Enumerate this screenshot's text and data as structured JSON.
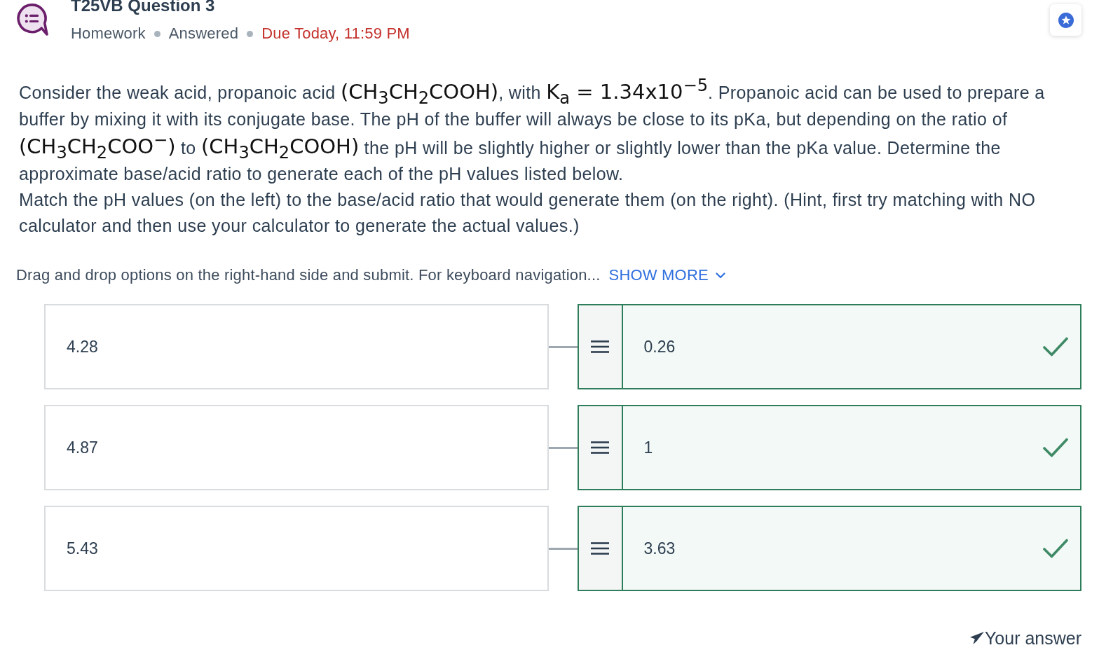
{
  "header": {
    "title": "T25VB Question 3",
    "meta": [
      {
        "kind": "type",
        "text": "Homework"
      },
      {
        "kind": "status",
        "text": "Answered"
      },
      {
        "kind": "due",
        "text": "Due Today, 11:59 PM"
      }
    ]
  },
  "question": {
    "paragraphs": [
      {
        "segments": [
          {
            "kind": "text",
            "text": "Consider the weak acid, propanoic acid "
          },
          {
            "kind": "math",
            "text": "(CH$_{3}$CH$_{2}$COOH)"
          },
          {
            "kind": "text",
            "text": ", with "
          },
          {
            "kind": "math",
            "text": "K$_{a}$ = 1.34x10$^{−5}$"
          },
          {
            "kind": "text",
            "text": ". Propanoic acid can be used to prepare a buffer by mixing it with its conjugate base. The pH of the buffer will always be close to its pKa, but depending on the ratio of "
          },
          {
            "kind": "math",
            "text": "(CH$_{3}$CH$_{2}$COO$^{−}$)"
          },
          {
            "kind": "text",
            "text": " to "
          },
          {
            "kind": "math",
            "text": "(CH$_{3}$CH$_{2}$COOH)"
          },
          {
            "kind": "text",
            "text": " the pH will be slightly higher or slightly lower than the pKa value. Determine the approximate base/acid ratio to generate each of the pH values listed below."
          }
        ]
      },
      {
        "segments": [
          {
            "kind": "text",
            "text": "Match the pH values (on the left) to the base/acid ratio that would generate them (on the right). (Hint, first try matching with NO calculator and then use your calculator to generate the actual values.)"
          }
        ]
      }
    ]
  },
  "instructions": {
    "text": "Drag and drop options on the right-hand side and submit. For keyboard navigation...",
    "link": "SHOW MORE"
  },
  "matches": [
    {
      "prompt": "4.28",
      "answer": "0.26",
      "correct": true
    },
    {
      "prompt": "4.87",
      "answer": "1",
      "correct": true
    },
    {
      "prompt": "5.43",
      "answer": "3.63",
      "correct": true
    }
  ],
  "footer": {
    "label": "Your answer"
  }
}
